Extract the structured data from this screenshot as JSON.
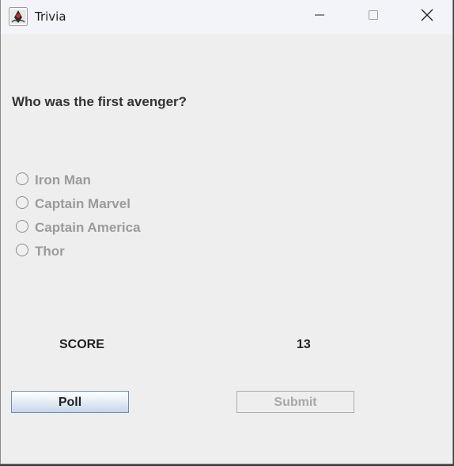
{
  "window": {
    "title": "Trivia",
    "app_icon": "java-duke-icon"
  },
  "quiz": {
    "question": "Who was the first avenger?",
    "options": [
      {
        "label": "Iron Man",
        "selected": false,
        "enabled": false
      },
      {
        "label": "Captain Marvel",
        "selected": false,
        "enabled": false
      },
      {
        "label": "Captain America",
        "selected": false,
        "enabled": false
      },
      {
        "label": "Thor",
        "selected": false,
        "enabled": false
      }
    ]
  },
  "score": {
    "label": "SCORE",
    "value": "13"
  },
  "buttons": {
    "poll_label": "Poll",
    "submit_label": "Submit",
    "submit_enabled": false
  },
  "colors": {
    "window_bg": "#eeeeee",
    "titlebar_bg": "#f3f4f9",
    "disabled_text": "#9b9b9b"
  }
}
